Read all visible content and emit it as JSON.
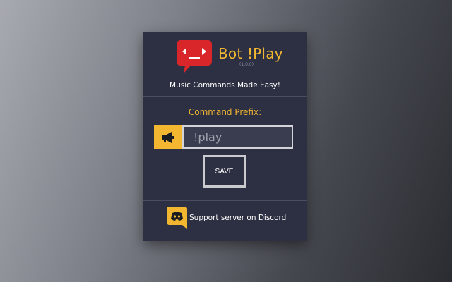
{
  "app": {
    "name": "Bot !Play",
    "version": "(1.0.0)",
    "tagline": "Music Commands Made Easy!"
  },
  "prefix": {
    "title": "Command Prefix:",
    "icon": "megaphone-icon",
    "placeholder": "!play",
    "value": ""
  },
  "actions": {
    "save_label": "SAVE"
  },
  "footer": {
    "discord_icon": "discord-icon",
    "discord_label": "Support server on Discord"
  },
  "colors": {
    "accent": "#f3b631",
    "panel": "#2d3042",
    "logo_red": "#d8262b"
  }
}
